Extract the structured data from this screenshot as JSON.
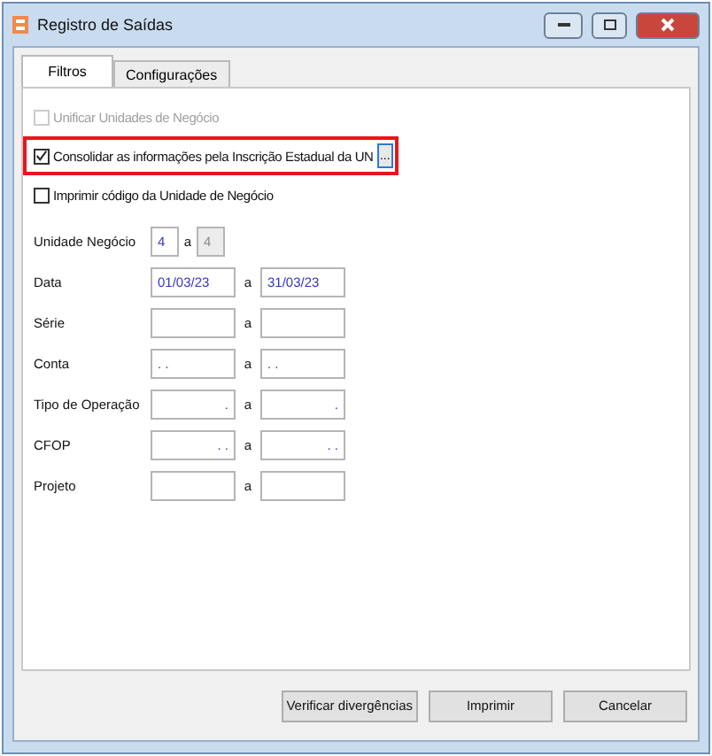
{
  "window": {
    "title": "Registro de Saídas"
  },
  "tabs": [
    {
      "label": "Filtros",
      "selected": true
    },
    {
      "label": "Configurações",
      "selected": false
    }
  ],
  "options": [
    {
      "label": "Unificar Unidades de Negócio",
      "checked": false,
      "disabled": true,
      "highlighted": false
    },
    {
      "label": "Consolidar as informações pela Inscrição Estadual da UN",
      "checked": true,
      "disabled": false,
      "highlighted": true,
      "button": "..."
    },
    {
      "label": "Imprimir código da Unidade de Negócio",
      "checked": false,
      "disabled": false,
      "highlighted": false
    }
  ],
  "ranges": [
    {
      "label": "Unidade Negócio",
      "kind": "small",
      "from": {
        "value": "4",
        "disabled": false
      },
      "separator": "a",
      "to": {
        "value": "4",
        "disabled": true
      }
    },
    {
      "label": "Data",
      "kind": "wide",
      "from": {
        "value": "01/03/23",
        "disabled": false
      },
      "separator": "a",
      "to": {
        "value": "31/03/23",
        "disabled": false
      }
    },
    {
      "label": "Série",
      "kind": "wide",
      "from": {
        "disabled": false
      },
      "separator": "a",
      "to": {
        "disabled": false
      }
    },
    {
      "label": "Conta",
      "kind": "wide",
      "from": {
        "value": ". .",
        "disabled": false
      },
      "separator": "a",
      "to": {
        "value": ". .",
        "disabled": false
      }
    },
    {
      "label": "Tipo de Operação",
      "kind": "wide",
      "from": {
        "value": ".",
        "right_aligned": true,
        "disabled": false
      },
      "separator": "a",
      "to": {
        "value": ".",
        "right_aligned": true,
        "disabled": false
      }
    },
    {
      "label": "CFOP",
      "kind": "wide",
      "from": {
        "value": ". .",
        "right_aligned": true,
        "disabled": false
      },
      "separator": "a",
      "to": {
        "value": ". .",
        "right_aligned": true,
        "disabled": false
      }
    },
    {
      "label": "Projeto",
      "kind": "wide",
      "from": {
        "disabled": false
      },
      "separator": "a",
      "to": {
        "disabled": false
      }
    }
  ],
  "buttons": [
    "Verificar divergências",
    "Imprimir",
    "Cancelar"
  ]
}
